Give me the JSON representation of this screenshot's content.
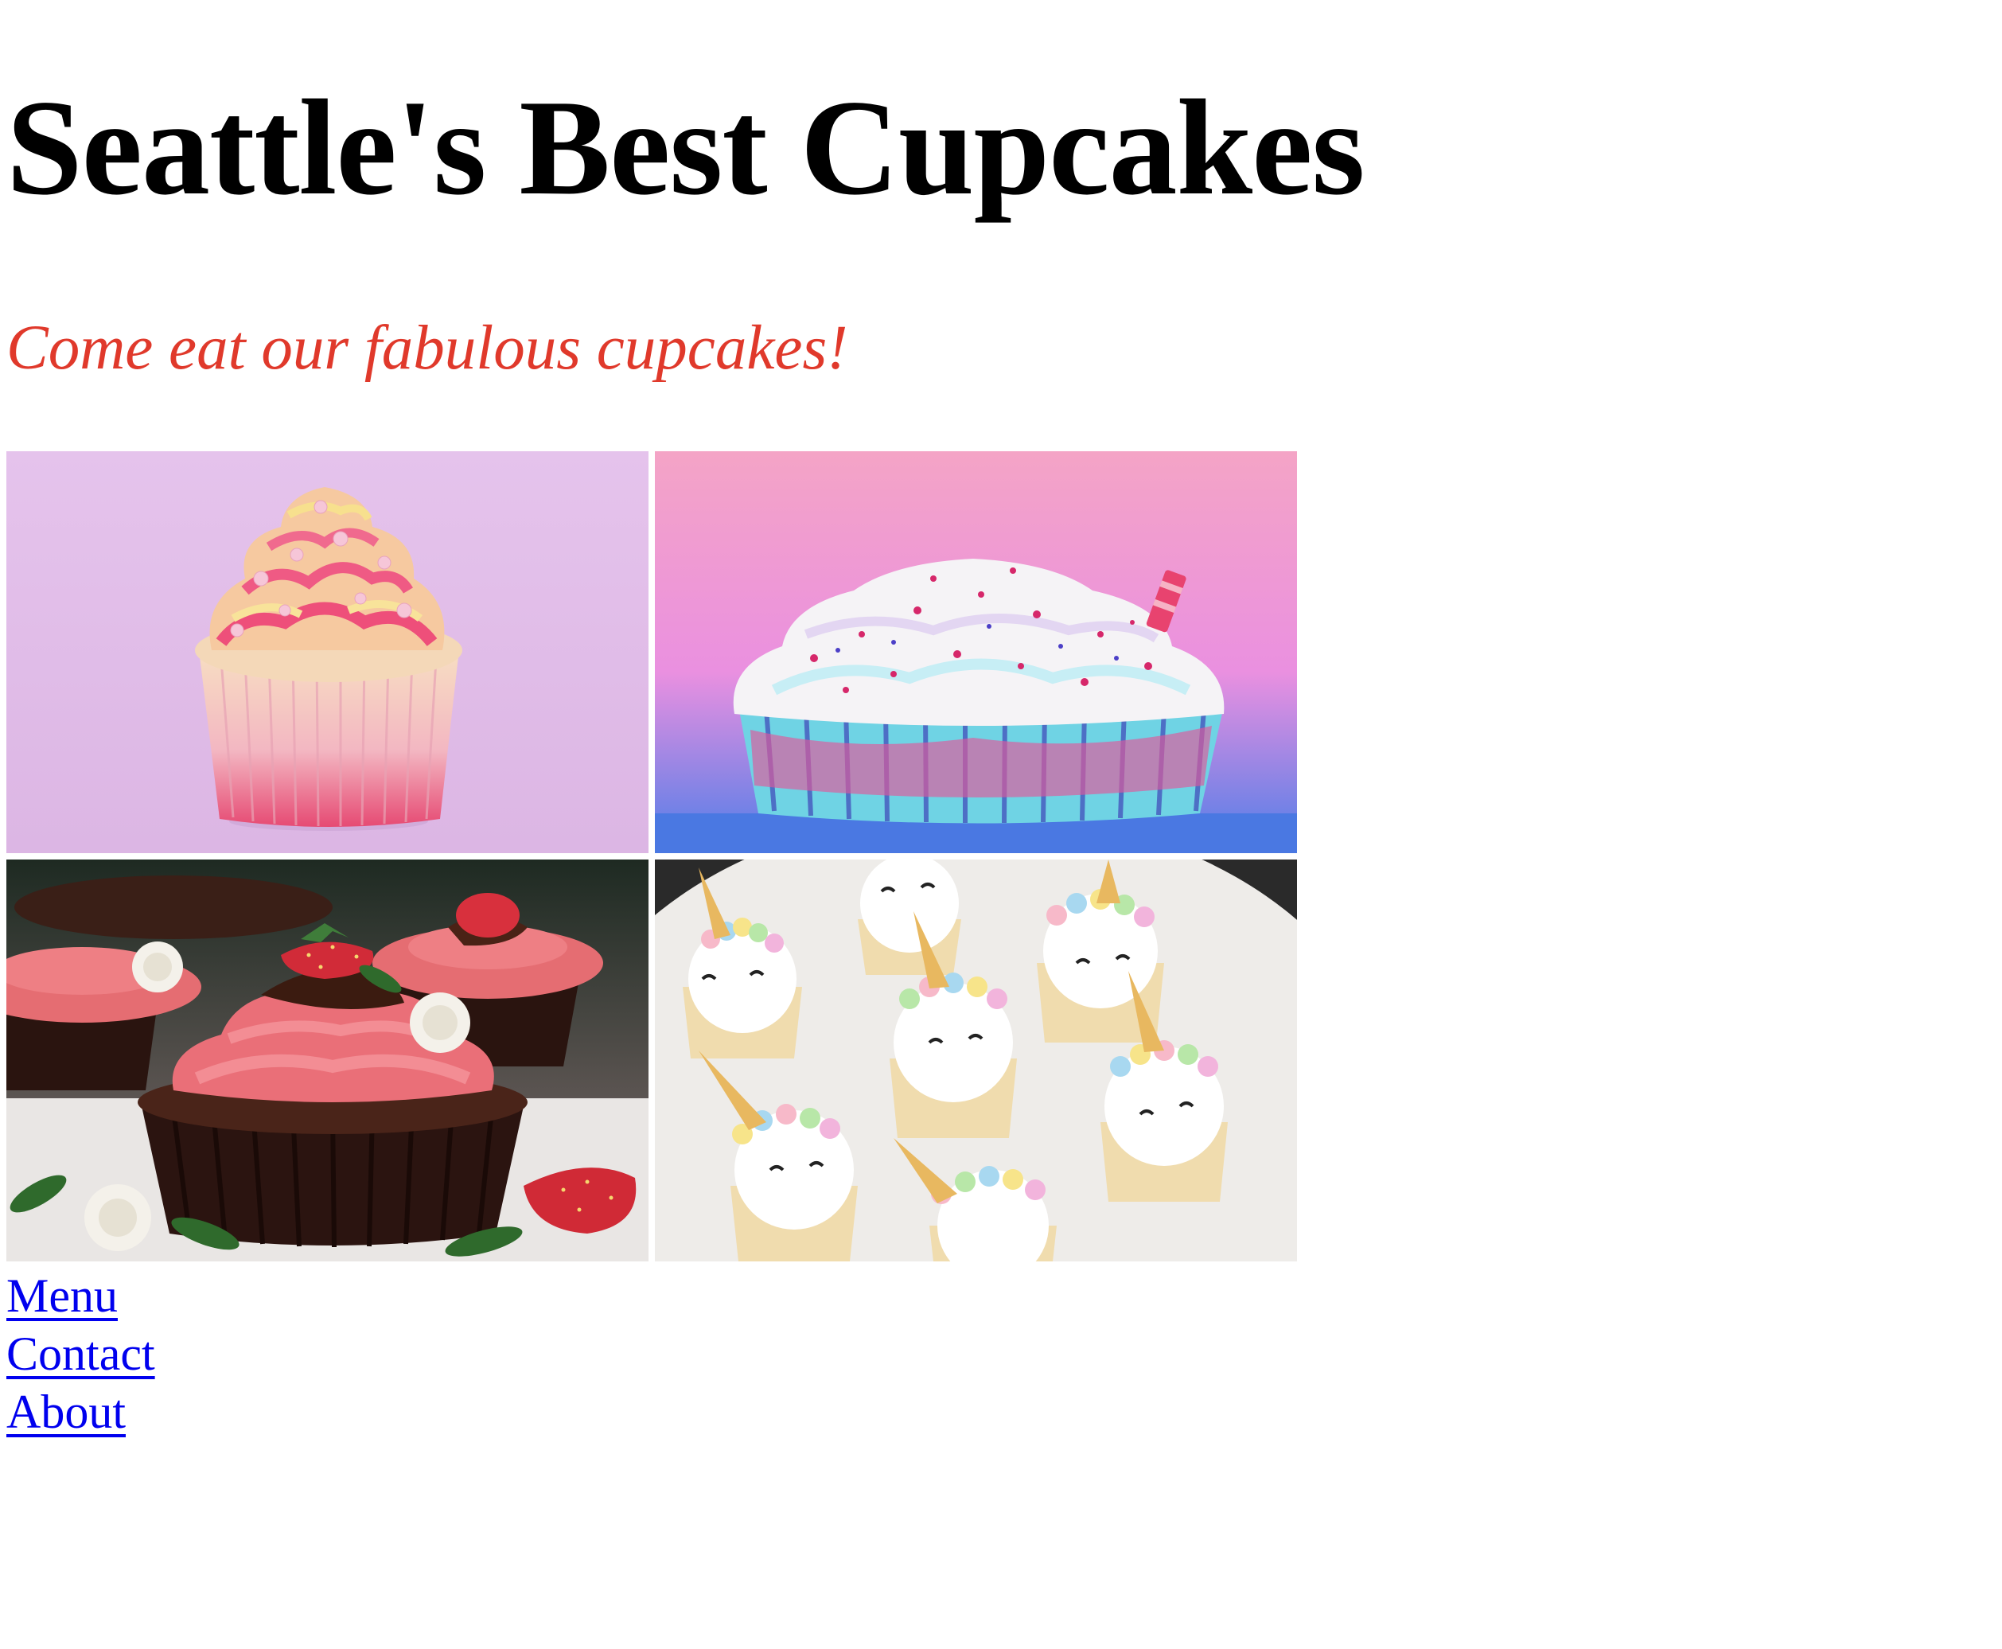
{
  "header": {
    "title": "Seattle's Best Cupcakes",
    "tagline": "Come eat our fabulous cupcakes!"
  },
  "gallery": {
    "images": [
      "cupcake-pink-swirl-photo",
      "cupcake-rainbow-sprinkles-photo",
      "cupcake-chocolate-strawberry-photo",
      "cupcake-unicorn-photo"
    ]
  },
  "nav": {
    "links": [
      {
        "label": "Menu"
      },
      {
        "label": "Contact"
      },
      {
        "label": "About"
      }
    ]
  },
  "colors": {
    "tagline": "#e0392b",
    "link": "#0000ee",
    "title": "#000000"
  }
}
